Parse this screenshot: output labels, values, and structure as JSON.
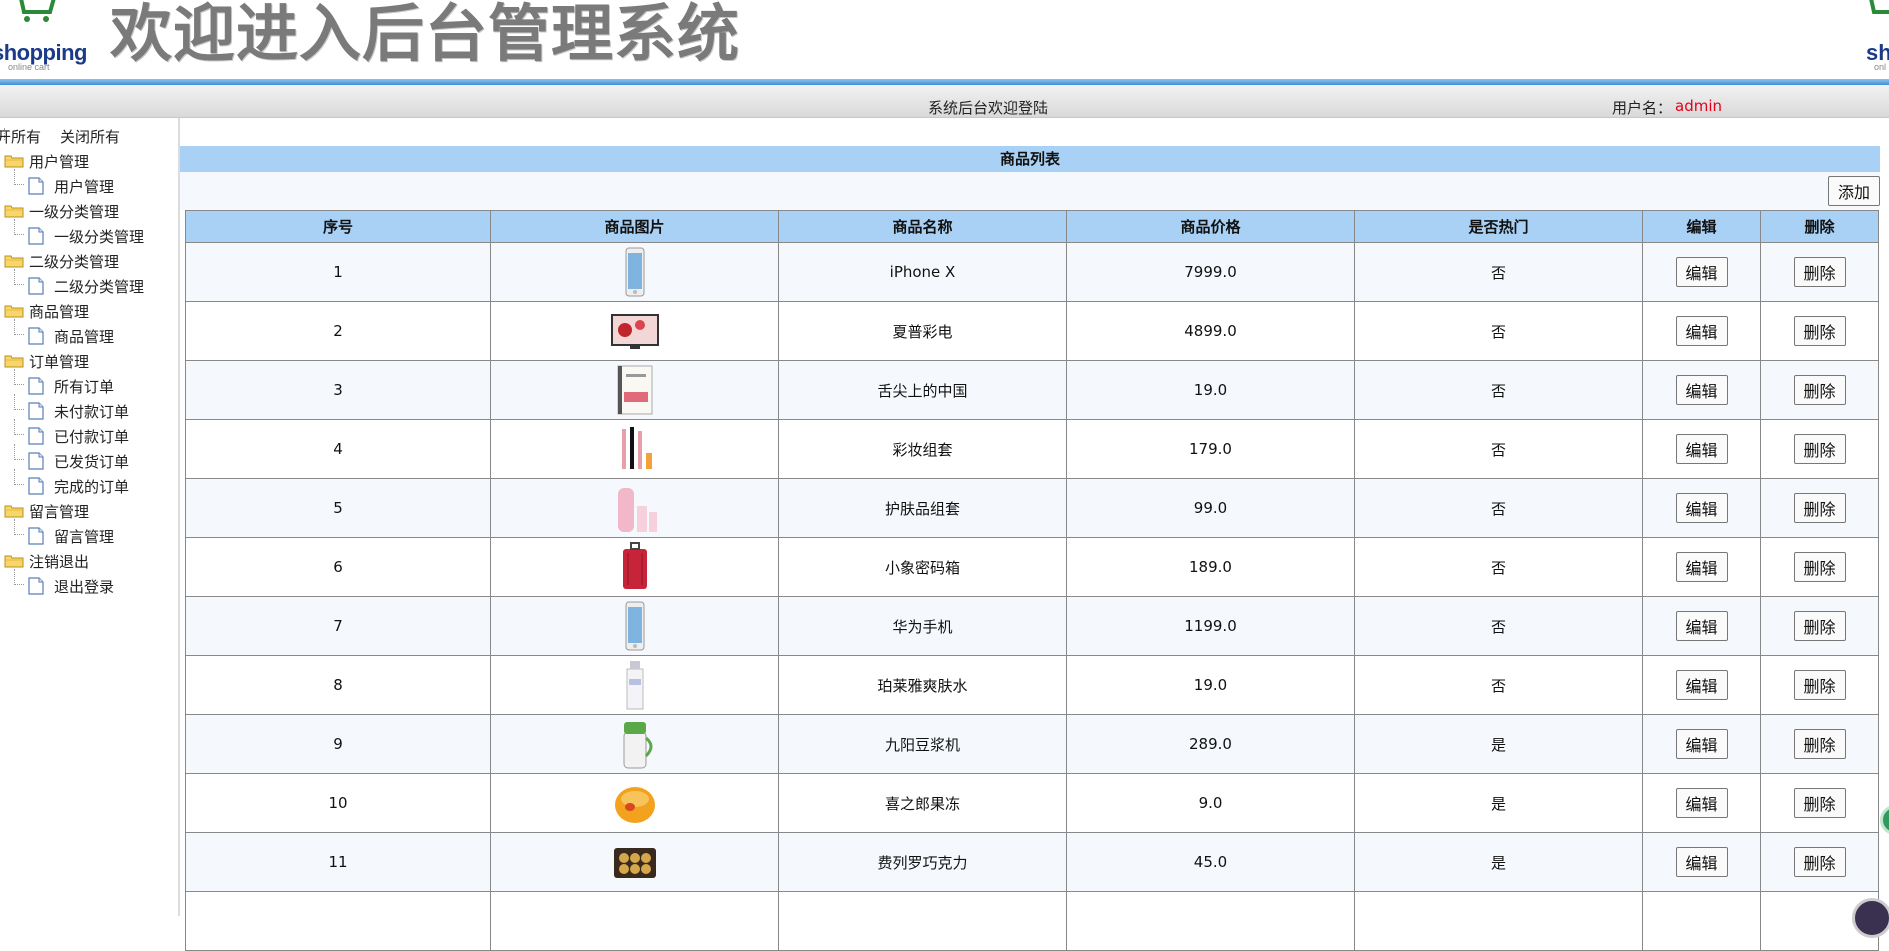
{
  "header": {
    "logo_text": "shopping",
    "logo_sub": "online cart",
    "banner_title": "欢迎进入后台管理系统",
    "right_logo_text": "sh",
    "right_logo_sub": "onl",
    "accent_color": "#3e8fd6"
  },
  "status_bar": {
    "welcome": "系统后台欢迎登陆",
    "user_label": "用户名：",
    "user_name": "admin",
    "user_name_color": "#e2001a"
  },
  "sidebar": {
    "expand_all": "开所有",
    "collapse_all": "关闭所有",
    "groups": [
      {
        "label": "用户管理",
        "items": [
          "用户管理"
        ]
      },
      {
        "label": "一级分类管理",
        "items": [
          "一级分类管理"
        ]
      },
      {
        "label": "二级分类管理",
        "items": [
          "二级分类管理"
        ]
      },
      {
        "label": "商品管理",
        "items": [
          "商品管理"
        ]
      },
      {
        "label": "订单管理",
        "items": [
          "所有订单",
          "未付款订单",
          "已付款订单",
          "已发货订单",
          "完成的订单"
        ]
      },
      {
        "label": "留言管理",
        "items": [
          "留言管理"
        ]
      },
      {
        "label": "注销退出",
        "items": [
          "退出登录"
        ]
      }
    ]
  },
  "main": {
    "caption": "商品列表",
    "add_label": "添加",
    "columns": [
      "序号",
      "商品图片",
      "商品名称",
      "商品价格",
      "是否热门",
      "编辑",
      "删除"
    ],
    "edit_label": "编辑",
    "delete_label": "删除",
    "rows": [
      {
        "id": "1",
        "image": "phone-image",
        "name": "iPhone X",
        "price": "7999.0",
        "hot": "否"
      },
      {
        "id": "2",
        "image": "tv-image",
        "name": "夏普彩电",
        "price": "4899.0",
        "hot": "否"
      },
      {
        "id": "3",
        "image": "book-image",
        "name": "舌尖上的中国",
        "price": "19.0",
        "hot": "否"
      },
      {
        "id": "4",
        "image": "makeup-image",
        "name": "彩妆组套",
        "price": "179.0",
        "hot": "否"
      },
      {
        "id": "5",
        "image": "skincare-image",
        "name": "护肤品组套",
        "price": "99.0",
        "hot": "否"
      },
      {
        "id": "6",
        "image": "suitcase-image",
        "name": "小象密码箱",
        "price": "189.0",
        "hot": "否"
      },
      {
        "id": "7",
        "image": "phone-image",
        "name": "华为手机",
        "price": "1199.0",
        "hot": "否"
      },
      {
        "id": "8",
        "image": "toner-image",
        "name": "珀莱雅爽肤水",
        "price": "19.0",
        "hot": "否"
      },
      {
        "id": "9",
        "image": "soymilk-machine-image",
        "name": "九阳豆浆机",
        "price": "289.0",
        "hot": "是"
      },
      {
        "id": "10",
        "image": "jelly-image",
        "name": "喜之郎果冻",
        "price": "9.0",
        "hot": "是"
      },
      {
        "id": "11",
        "image": "chocolate-image",
        "name": "费列罗巧克力",
        "price": "45.0",
        "hot": "是"
      }
    ]
  }
}
